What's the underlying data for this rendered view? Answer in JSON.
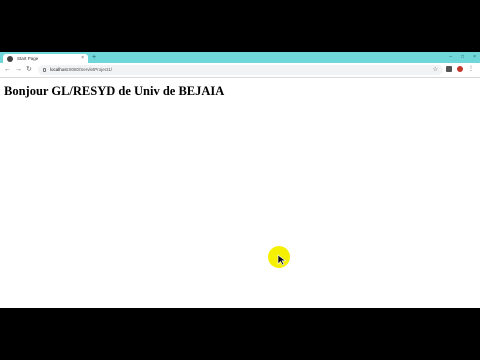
{
  "browser": {
    "tab": {
      "title": "Start Page",
      "close_glyph": "×"
    },
    "new_tab_glyph": "+",
    "window_controls": [
      "–",
      "□",
      "×"
    ],
    "nav": {
      "back_glyph": "←",
      "forward_glyph": "→",
      "reload_glyph": "↻"
    },
    "address": {
      "host": "localhost",
      "path": ":8080/ServletProject1/"
    },
    "star_glyph": "☆",
    "menu_glyph": "⋮",
    "accent_color": "#6fd6da"
  },
  "page": {
    "heading": "Bonjour GL/RESYD de Univ de BEJAIA"
  },
  "pointer": {
    "highlight_color": "#f4f000",
    "icon": "cursor-arrow-icon"
  }
}
